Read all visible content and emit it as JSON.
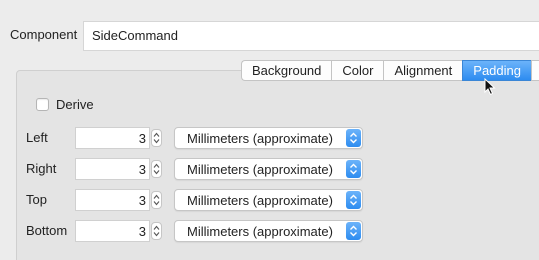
{
  "component": {
    "label": "Component",
    "value": "SideCommand"
  },
  "tabs": [
    {
      "label": "Background",
      "active": false
    },
    {
      "label": "Color",
      "active": false
    },
    {
      "label": "Alignment",
      "active": false
    },
    {
      "label": "Padding",
      "active": true
    }
  ],
  "derive": {
    "label": "Derive",
    "checked": false
  },
  "rows": [
    {
      "label": "Left",
      "value": "3",
      "unit": "Millimeters (approximate)"
    },
    {
      "label": "Right",
      "value": "3",
      "unit": "Millimeters (approximate)"
    },
    {
      "label": "Top",
      "value": "3",
      "unit": "Millimeters (approximate)"
    },
    {
      "label": "Bottom",
      "value": "3",
      "unit": "Millimeters (approximate)"
    }
  ],
  "colors": {
    "accent": "#2d8cf0",
    "panel": "#e4e4e4",
    "window": "#ececec"
  }
}
